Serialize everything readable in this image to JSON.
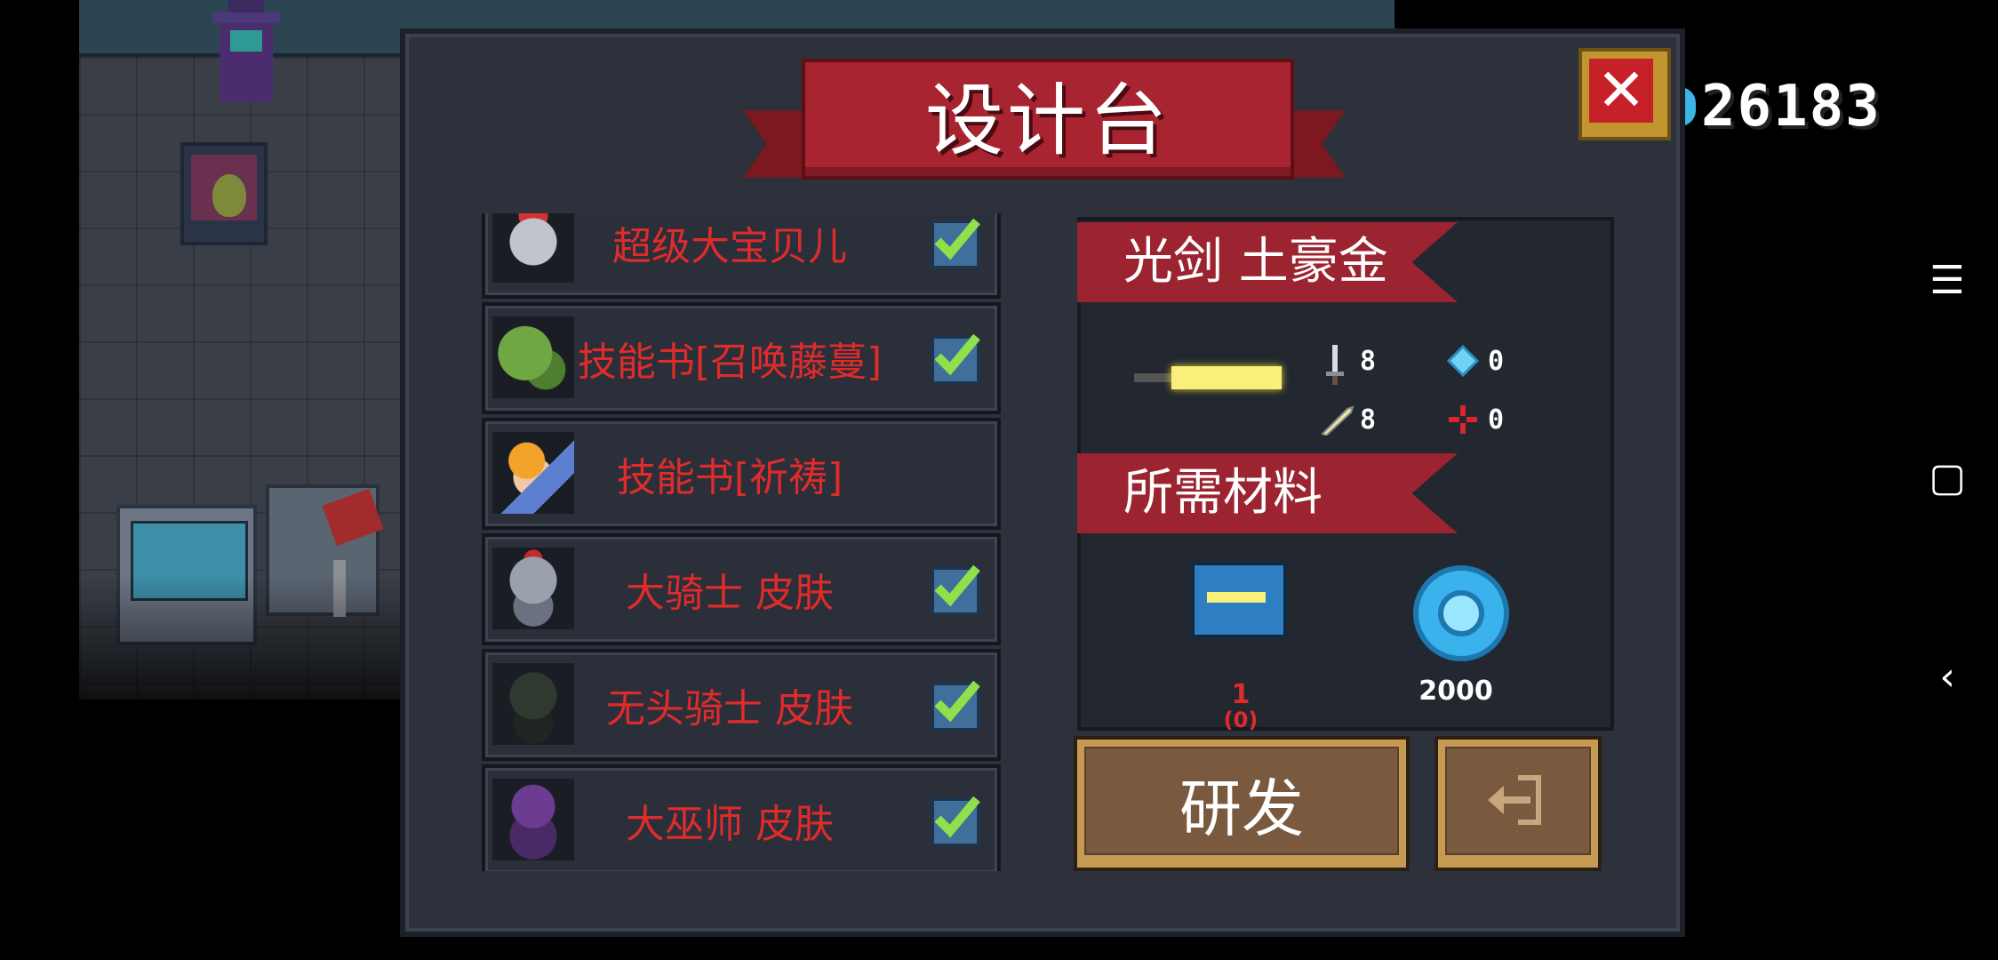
{
  "title": "设计台",
  "gem_count": "26183",
  "items": [
    {
      "name": "超级大宝贝儿",
      "owned": true,
      "icon": "baby-robot-icon"
    },
    {
      "name": "技能书[召唤藤蔓]",
      "owned": true,
      "icon": "vine-dragon-icon"
    },
    {
      "name": "技能书[祈祷]",
      "owned": false,
      "icon": "praying-hand-icon"
    },
    {
      "name": "大骑士 皮肤",
      "owned": true,
      "icon": "knight-icon"
    },
    {
      "name": "无头骑士 皮肤",
      "owned": true,
      "icon": "headless-knight-icon"
    },
    {
      "name": "大巫师 皮肤",
      "owned": true,
      "icon": "wizard-icon"
    }
  ],
  "selected": {
    "name": "光剑  土豪金",
    "stats": {
      "attack": "8",
      "energy": "0",
      "speed": "8",
      "crit": "0"
    }
  },
  "materials_label": "所需材料",
  "materials": [
    {
      "icon": "blueprint-icon",
      "count": "1",
      "owned": "(0)"
    },
    {
      "icon": "gem-icon",
      "count": "2000"
    }
  ],
  "develop_label": "研发",
  "colors": {
    "accent_red": "#a82431",
    "text_red": "#e02b2b",
    "panel": "#2c313c",
    "button_brown": "#7a5a3f",
    "gem_blue": "#3ab3ec"
  }
}
